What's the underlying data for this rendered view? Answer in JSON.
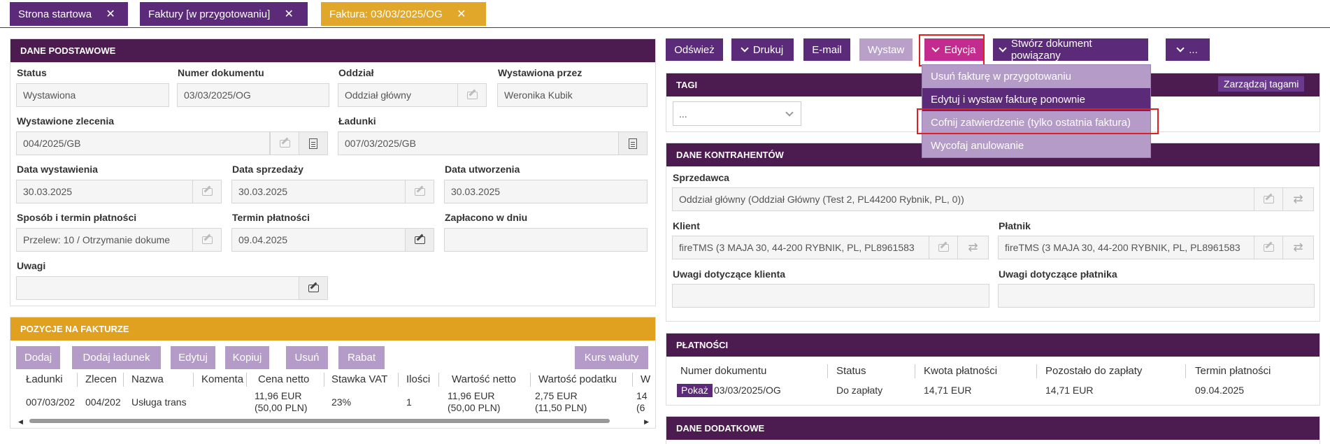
{
  "tabs": [
    {
      "label": "Strona startowa"
    },
    {
      "label": "Faktury [w przygotowaniu]"
    },
    {
      "label": "Faktura: 03/03/2025/OG"
    }
  ],
  "basic": {
    "title": "DANE PODSTAWOWE",
    "status_label": "Status",
    "status": "Wystawiona",
    "number_label": "Numer dokumentu",
    "number": "03/03/2025/OG",
    "branch_label": "Oddział",
    "branch": "Oddział główny",
    "issued_by_label": "Wystawiona przez",
    "issued_by": "Weronika Kubik",
    "orders_label": "Wystawione zlecenia",
    "orders": "004/2025/GB",
    "loads_label": "Ładunki",
    "loads": "007/03/2025/GB",
    "issue_date_label": "Data wystawienia",
    "issue_date": "30.03.2025",
    "sale_date_label": "Data sprzedaży",
    "sale_date": "30.03.2025",
    "created_label": "Data utworzenia",
    "created": "30.03.2025",
    "payment_method_label": "Sposób i termin płatności",
    "payment_method": "Przelew: 10 / Otrzymanie dokume",
    "due_label": "Termin płatności",
    "due": "09.04.2025",
    "paid_label": "Zapłacono w dniu",
    "paid": "",
    "notes_label": "Uwagi",
    "notes": ""
  },
  "toolbar": {
    "refresh": "Odśwież",
    "print": "Drukuj",
    "email": "E-mail",
    "issue": "Wystaw",
    "edit": "Edycja",
    "create_related": "Stwórz dokument powiązany",
    "more": "..."
  },
  "edit_menu": [
    {
      "label": "Usuń fakturę w przygotowaniu"
    },
    {
      "label": "Edytuj i wystaw fakturę ponownie"
    },
    {
      "label": "Cofnij zatwierdzenie (tylko ostatnia faktura)"
    },
    {
      "label": "Wycofaj anulowanie"
    }
  ],
  "tags": {
    "title": "TAGI",
    "manage": "Zarządzaj tagami",
    "select": "..."
  },
  "parties": {
    "title": "DANE KONTRAHENTÓW",
    "seller_label": "Sprzedawca",
    "seller": "Oddział główny  (Oddział Główny  (Test 2, PL44200 Rybnik, PL, 0))",
    "client_label": "Klient",
    "client": "fireTMS (3 MAJA 30, 44-200 RYBNIK, PL, PL8961583",
    "payer_label": "Płatnik",
    "payer": "fireTMS (3 MAJA 30, 44-200 RYBNIK, PL, PL8961583",
    "client_notes_label": "Uwagi dotyczące klienta",
    "payer_notes_label": "Uwagi dotyczące płatnika"
  },
  "positions": {
    "title": "POZYCJE NA FAKTURZE",
    "buttons": {
      "add": "Dodaj",
      "add_load": "Dodaj ładunek",
      "edit": "Edytuj",
      "copy": "Kopiuj",
      "delete": "Usuń",
      "discount": "Rabat",
      "rate": "Kurs waluty"
    },
    "columns": [
      "Ładunki",
      "Zlecen",
      "Nazwa",
      "Komenta",
      "Cena netto",
      "Stawka VAT",
      "Ilości",
      "Wartość netto",
      "Wartość podatku",
      "W"
    ],
    "row": {
      "loads": "007/03/202",
      "order": "004/202",
      "name": "Usługa trans",
      "comment": "",
      "price1": "11,96 EUR",
      "price2": "(50,00 PLN)",
      "vat": "23%",
      "qty": "1",
      "net1": "11,96 EUR",
      "net2": "(50,00 PLN)",
      "tax1": "2,75 EUR",
      "tax2": "(11,50 PLN)",
      "w1": "14",
      "w2": "(6"
    }
  },
  "payments": {
    "title": "PŁATNOŚCI",
    "columns": [
      "Numer dokumentu",
      "Status",
      "Kwota płatności",
      "Pozostało do zapłaty",
      "Termin płatności"
    ],
    "row": {
      "show": "Pokaż",
      "number": "03/03/2025/OG",
      "status": "Do zapłaty",
      "amount": "14,71 EUR",
      "remaining": "14,71 EUR",
      "due": "09.04.2025"
    }
  },
  "extra": {
    "title": "DANE DODATKOWE"
  }
}
